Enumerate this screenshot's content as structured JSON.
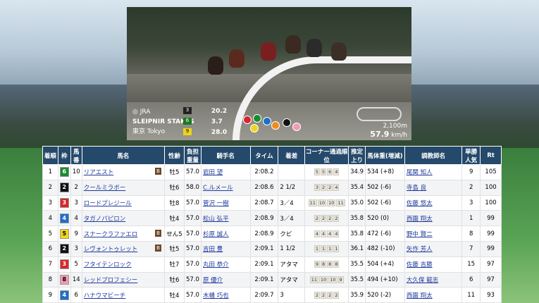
{
  "video": {
    "jra_label": "JRA",
    "race_name": "SLEIPNIR STAKES",
    "venue": "東京",
    "venue_en": "Tokyo",
    "distance": "2,100m",
    "speed": "57.9",
    "speed_unit": "km/h",
    "odds": [
      {
        "num": "3",
        "val": "20.2",
        "color": "#222222"
      },
      {
        "num": "6",
        "val": "3.7",
        "color": "#1b7a1f"
      },
      {
        "num": "9",
        "val": "28.0",
        "color": "#f0d21a"
      }
    ]
  },
  "table": {
    "headers": {
      "chakujun": "着順",
      "waku": "枠",
      "umaban": "馬番",
      "bamei": "馬名",
      "seirei": "性齢",
      "futan": "負担重量",
      "kishu": "騎手名",
      "time": "タイム",
      "chakusa": "着差",
      "corner": "コーナー通過順位",
      "agari": "推定上り",
      "bataiju": "馬体重(増減)",
      "chokyoshi": "調教師名",
      "ninki": "単勝人気",
      "rt": "Rt"
    },
    "rows": [
      {
        "rank": "1",
        "waku": "6",
        "umaban": "10",
        "name": "リアエスト",
        "blinker": "B",
        "sex": "牡5",
        "weight": "57.0",
        "jockey": "岩田 望",
        "time": "2:08.2",
        "margin": "",
        "corner": [
          "5",
          "5",
          "6",
          "4"
        ],
        "agari": "34.9",
        "bw": "534",
        "bwd": "(+8)",
        "trainer": "尾関 知人",
        "pop": "9",
        "rt": "105"
      },
      {
        "rank": "2",
        "waku": "2",
        "umaban": "2",
        "name": "クールミラボー",
        "blinker": "",
        "sex": "牡6",
        "weight": "58.0",
        "jockey": "C.ルメール",
        "time": "2:08.6",
        "margin": "2 1/2",
        "corner": [
          "3",
          "2",
          "2",
          "4"
        ],
        "agari": "35.4",
        "bw": "502",
        "bwd": "(-6)",
        "trainer": "寺島 良",
        "pop": "2",
        "rt": "100"
      },
      {
        "rank": "3",
        "waku": "3",
        "umaban": "3",
        "name": "ロードプレジール",
        "blinker": "",
        "sex": "牡8",
        "weight": "57.0",
        "jockey": "菅沢 一樹",
        "time": "2:08.7",
        "margin": "3／4",
        "corner": [
          "11",
          "10",
          "10",
          "11"
        ],
        "agari": "35.0",
        "bw": "502",
        "bwd": "(-6)",
        "trainer": "佐藤 悠太",
        "pop": "3",
        "rt": "100"
      },
      {
        "rank": "4",
        "waku": "4",
        "umaban": "4",
        "name": "タガノパピロン",
        "blinker": "",
        "sex": "牡4",
        "weight": "57.0",
        "jockey": "松山 弘平",
        "time": "2:08.9",
        "margin": "3／4",
        "corner": [
          "2",
          "2",
          "2",
          "2"
        ],
        "agari": "35.8",
        "bw": "520",
        "bwd": "(0)",
        "trainer": "西園 翔太",
        "pop": "1",
        "rt": "99"
      },
      {
        "rank": "5",
        "waku": "5",
        "umaban": "9",
        "name": "スナークラファエロ",
        "blinker": "B",
        "sex": "せん5",
        "weight": "57.0",
        "jockey": "杉原 誠人",
        "time": "2:08.9",
        "margin": "クビ",
        "corner": [
          "4",
          "4",
          "4",
          "4"
        ],
        "agari": "35.8",
        "bw": "472",
        "bwd": "(-6)",
        "trainer": "野中 賢二",
        "pop": "8",
        "rt": "99"
      },
      {
        "rank": "6",
        "waku": "2",
        "umaban": "3",
        "name": "レヴォントゥレット",
        "blinker": "B",
        "sex": "牡5",
        "weight": "57.0",
        "jockey": "吉田 豊",
        "time": "2:09.1",
        "margin": "1 1/2",
        "corner": [
          "1",
          "1",
          "1",
          "1"
        ],
        "agari": "36.1",
        "bw": "482",
        "bwd": "(-10)",
        "trainer": "矢作 芳人",
        "pop": "7",
        "rt": "99"
      },
      {
        "rank": "7",
        "waku": "3",
        "umaban": "5",
        "name": "フタイテンロック",
        "blinker": "",
        "sex": "牡7",
        "weight": "57.0",
        "jockey": "丸田 恭介",
        "time": "2:09.1",
        "margin": "アタマ",
        "corner": [
          "9",
          "8",
          "8",
          "8"
        ],
        "agari": "35.5",
        "bw": "504",
        "bwd": "(+4)",
        "trainer": "佐藤 吉勝",
        "pop": "15",
        "rt": "97"
      },
      {
        "rank": "8",
        "waku": "8",
        "umaban": "14",
        "name": "レッドプロフェシー",
        "blinker": "",
        "sex": "牡6",
        "weight": "57.0",
        "jockey": "原 優介",
        "time": "2:09.1",
        "margin": "アタマ",
        "corner": [
          "11",
          "10",
          "10",
          "9"
        ],
        "agari": "35.5",
        "bw": "494",
        "bwd": "(+10)",
        "trainer": "大久保 龍志",
        "pop": "6",
        "rt": "97"
      },
      {
        "rank": "9",
        "waku": "4",
        "umaban": "6",
        "name": "ハナウマビーチ",
        "blinker": "",
        "sex": "牡4",
        "weight": "57.0",
        "jockey": "木幡 巧也",
        "time": "2:09.7",
        "margin": "3",
        "corner": [
          "2",
          "2",
          "2",
          "2"
        ],
        "agari": "35.9",
        "bw": "520",
        "bwd": "(-2)",
        "trainer": "西園 翔太",
        "pop": "11",
        "rt": "93"
      }
    ]
  },
  "waku_colors": {
    "1": {
      "bg": "#ffffff",
      "fg": "#000000"
    },
    "2": {
      "bg": "#111111",
      "fg": "#ffffff"
    },
    "3": {
      "bg": "#d8262a",
      "fg": "#ffffff"
    },
    "4": {
      "bg": "#1e6fc9",
      "fg": "#ffffff"
    },
    "5": {
      "bg": "#f1d51a",
      "fg": "#000000"
    },
    "6": {
      "bg": "#1b8a2e",
      "fg": "#ffffff"
    },
    "7": {
      "bg": "#f18a23",
      "fg": "#ffffff"
    },
    "8": {
      "bg": "#f39bb3",
      "fg": "#000000"
    }
  }
}
